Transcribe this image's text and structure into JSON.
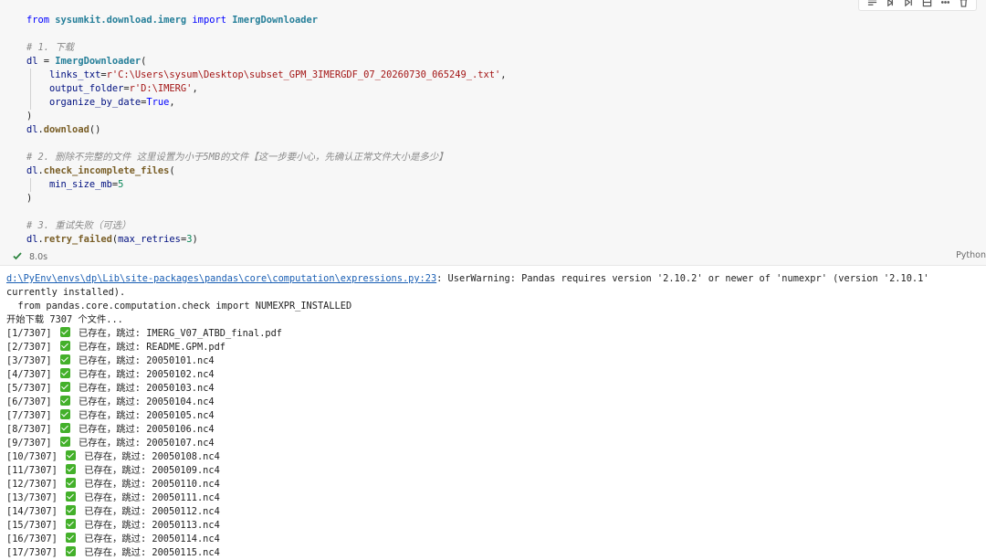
{
  "cell": {
    "code_lines": [
      [
        {
          "t": "from ",
          "c": "kw"
        },
        {
          "t": "sysumkit.download.imerg",
          "c": "mod"
        },
        {
          "t": " import ",
          "c": "kw"
        },
        {
          "t": "ImergDownloader",
          "c": "cls"
        }
      ],
      [],
      [
        {
          "t": "# 1. 下载",
          "c": "cm"
        }
      ],
      [
        {
          "t": "dl",
          "c": "var"
        },
        {
          "t": " = ",
          "c": "p"
        },
        {
          "t": "ImergDownloader",
          "c": "cls"
        },
        {
          "t": "(",
          "c": "p"
        }
      ],
      [
        {
          "t": "    ",
          "c": "g"
        },
        {
          "t": "links_txt",
          "c": "var"
        },
        {
          "t": "=",
          "c": "p"
        },
        {
          "t": "r'C:\\Users\\sysum\\Desktop\\subset_GPM_3IMERGDF_07_20260730_065249_.txt'",
          "c": "str"
        },
        {
          "t": ",",
          "c": "p"
        }
      ],
      [
        {
          "t": "    ",
          "c": "g"
        },
        {
          "t": "output_folder",
          "c": "var"
        },
        {
          "t": "=",
          "c": "p"
        },
        {
          "t": "r'D:\\IMERG'",
          "c": "str"
        },
        {
          "t": ",",
          "c": "p"
        }
      ],
      [
        {
          "t": "    ",
          "c": "g"
        },
        {
          "t": "organize_by_date",
          "c": "var"
        },
        {
          "t": "=",
          "c": "p"
        },
        {
          "t": "True",
          "c": "bool"
        },
        {
          "t": ",",
          "c": "p"
        }
      ],
      [
        {
          "t": ")",
          "c": "p"
        }
      ],
      [
        {
          "t": "dl",
          "c": "var"
        },
        {
          "t": ".",
          "c": "p"
        },
        {
          "t": "download",
          "c": "fn"
        },
        {
          "t": "()",
          "c": "p"
        }
      ],
      [],
      [
        {
          "t": "# 2. 删除不完整的文件 这里设置为小于5MB的文件【这一步要小心，先确认正常文件大小是多少】",
          "c": "cm"
        }
      ],
      [
        {
          "t": "dl",
          "c": "var"
        },
        {
          "t": ".",
          "c": "p"
        },
        {
          "t": "check_incomplete_files",
          "c": "fn"
        },
        {
          "t": "(",
          "c": "p"
        }
      ],
      [
        {
          "t": "    ",
          "c": "g"
        },
        {
          "t": "min_size_mb",
          "c": "var"
        },
        {
          "t": "=",
          "c": "p"
        },
        {
          "t": "5",
          "c": "num"
        }
      ],
      [
        {
          "t": ")",
          "c": "p"
        }
      ],
      [],
      [
        {
          "t": "# 3. 重试失败（可选）",
          "c": "cm"
        }
      ],
      [
        {
          "t": "dl",
          "c": "var"
        },
        {
          "t": ".",
          "c": "p"
        },
        {
          "t": "retry_failed",
          "c": "fn"
        },
        {
          "t": "(",
          "c": "p"
        },
        {
          "t": "max_retries",
          "c": "var"
        },
        {
          "t": "=",
          "c": "p"
        },
        {
          "t": "3",
          "c": "num"
        },
        {
          "t": ")",
          "c": "p"
        }
      ]
    ],
    "exec_time": "8.0s",
    "language": "Python",
    "toolbar_icons": [
      "run-by-line-icon",
      "execute-above-icon",
      "execute-below-icon",
      "split-cell-icon",
      "more-icon",
      "delete-icon"
    ]
  },
  "output": {
    "warning_path": "d:\\PyEnv\\envs\\dp\\Lib\\site-packages\\pandas\\core\\computation\\expressions.py:23",
    "warning_text": ": UserWarning: Pandas requires version '2.10.2' or newer of 'numexpr' (version '2.10.1' currently installed).",
    "import_line": "  from pandas.core.computation.check import NUMEXPR_INSTALLED",
    "start_line": "开始下载 7307 个文件...",
    "skip_text": "已存在，跳过:",
    "entries": [
      {
        "idx": "[1/7307]",
        "file": "IMERG_V07_ATBD_final.pdf"
      },
      {
        "idx": "[2/7307]",
        "file": "README.GPM.pdf"
      },
      {
        "idx": "[3/7307]",
        "file": "20050101.nc4"
      },
      {
        "idx": "[4/7307]",
        "file": "20050102.nc4"
      },
      {
        "idx": "[5/7307]",
        "file": "20050103.nc4"
      },
      {
        "idx": "[6/7307]",
        "file": "20050104.nc4"
      },
      {
        "idx": "[7/7307]",
        "file": "20050105.nc4"
      },
      {
        "idx": "[8/7307]",
        "file": "20050106.nc4"
      },
      {
        "idx": "[9/7307]",
        "file": "20050107.nc4"
      },
      {
        "idx": "[10/7307]",
        "file": "20050108.nc4"
      },
      {
        "idx": "[11/7307]",
        "file": "20050109.nc4"
      },
      {
        "idx": "[12/7307]",
        "file": "20050110.nc4"
      },
      {
        "idx": "[13/7307]",
        "file": "20050111.nc4"
      },
      {
        "idx": "[14/7307]",
        "file": "20050112.nc4"
      },
      {
        "idx": "[15/7307]",
        "file": "20050113.nc4"
      },
      {
        "idx": "[16/7307]",
        "file": "20050114.nc4"
      },
      {
        "idx": "[17/7307]",
        "file": "20050115.nc4"
      }
    ]
  },
  "colors": {
    "cell_bg": "#f7f7f7",
    "keyword": "#0000ff",
    "string": "#a31515",
    "comment": "#8a8a8a",
    "link": "#1a5fb4",
    "check": "#43b02a"
  }
}
